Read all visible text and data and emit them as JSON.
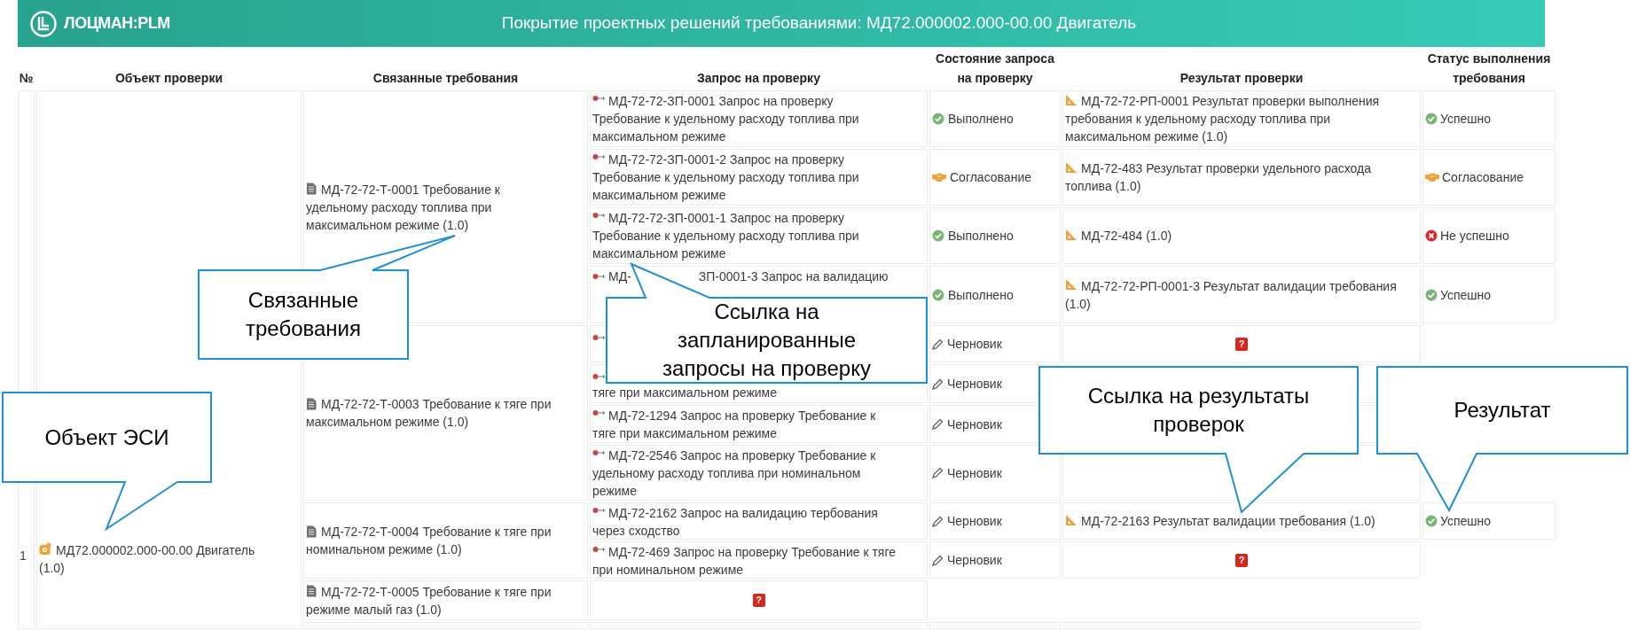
{
  "header": {
    "logo": "ЛОЦМАН:PLM",
    "title": "Покрытие проектных решений требованиями: МД72.000002.000-00.00 Двигатель"
  },
  "table": {
    "columns": [
      "№",
      "Объект проверки",
      "Связанные требования",
      "Запрос на проверку",
      "Состояние запроса на проверку",
      "Результат проверки",
      "Статус выполнения требования"
    ],
    "rows": [
      {
        "number": "1",
        "object": "МД72.000002.000-00.00 Двигатель (1.0)",
        "requirements": [
          {
            "text": "МД-72-72-Т-0001 Требование к удельному расходу топлива при максимальном режиме (1.0)",
            "requests": [
              {
                "kind": "link",
                "text": "МД-72-72-ЗП-0001 Запрос на проверку Требование к удельному расходу топлива при максимальном режиме",
                "state": {
                  "kind": "done",
                  "label": "Выполнено"
                },
                "result": {
                  "kind": "link",
                  "text": "МД-72-72-РП-0001 Результат проверки выполнения требования к удельному расходу топлива при максимальном режиме (1.0)"
                },
                "status": {
                  "kind": "success",
                  "label": "Успешно"
                }
              },
              {
                "kind": "link",
                "text": "МД-72-72-ЗП-0001-2 Запрос на проверку Требование к удельному расходу топлива при максимальном режиме",
                "state": {
                  "kind": "approval",
                  "label": "Согласование"
                },
                "result": {
                  "kind": "link",
                  "text": "МД-72-483 Результат проверки удельного расхода топлива (1.0)"
                },
                "status": {
                  "kind": "approval",
                  "label": "Согласование"
                }
              },
              {
                "kind": "link",
                "text": "МД-72-72-ЗП-0001-1 Запрос на проверку Требование к удельному расходу топлива при максимальном режиме",
                "state": {
                  "kind": "done",
                  "label": "Выполнено"
                },
                "result": {
                  "kind": "link",
                  "text": "МД-72-484 (1.0)"
                },
                "status": {
                  "kind": "fail",
                  "label": "Не успешно"
                }
              },
              {
                "kind": "split",
                "text": "МД-",
                "text_after": "ЗП-0001-3 Запрос на валидацию",
                "state": {
                  "kind": "done",
                  "label": "Выполнено"
                },
                "result": {
                  "kind": "link",
                  "text": "МД-72-72-РП-0001-3 Результат валидации требования (1.0)"
                },
                "status": {
                  "kind": "success",
                  "label": "Успешно"
                }
              }
            ]
          },
          {
            "text": "МД-72-72-Т-0003 Требование к тяге при максимальном режиме (1.0)",
            "requests": [
              {
                "kind": "covered",
                "state": {
                  "kind": "draft",
                  "label": "Черновик"
                },
                "result": {
                  "kind": "missing",
                  "label": "?"
                }
              },
              {
                "kind": "covered",
                "text": "тяге при максимальном режиме",
                "state": {
                  "kind": "draft",
                  "label": "Черновик"
                }
              },
              {
                "kind": "link",
                "text": "МД-72-1294 Запрос на проверку Требование к тяге при максимальном режиме",
                "state": {
                  "kind": "draft",
                  "label": "Черновик"
                }
              },
              {
                "kind": "link",
                "text": "МД-72-2546 Запрос на проверку Требование к удельному расходу топлива при номинальном режиме",
                "state": {
                  "kind": "draft",
                  "label": "Черновик"
                }
              }
            ]
          },
          {
            "text": "МД-72-72-Т-0004 Требование к тяге при номинальном режиме (1.0)",
            "requests": [
              {
                "kind": "link",
                "text": "МД-72-2162 Запрос на валидацию тербования через сходство",
                "state": {
                  "kind": "draft",
                  "label": "Черновик"
                },
                "result": {
                  "kind": "link",
                  "text": "МД-72-2163 Результат валидации требования (1.0)"
                },
                "status": {
                  "kind": "success",
                  "label": "Успешно"
                }
              },
              {
                "kind": "link",
                "text": "МД-72-469 Запрос на проверку Требование к тяге при номинальном режиме",
                "state": {
                  "kind": "draft",
                  "label": "Черновик"
                },
                "result": {
                  "kind": "missing",
                  "label": "?"
                }
              }
            ]
          },
          {
            "text": "МД-72-72-Т-0005 Требование к тяге при режиме малый газ (1.0)",
            "missing_requests": {
              "label": "?"
            }
          }
        ]
      }
    ]
  },
  "callouts": [
    {
      "text": "Связанные\nтребования"
    },
    {
      "text": "Ссылка на\nзапланированные\nзапросы на проверку"
    },
    {
      "text": "Ссылка на результаты\nпроверок"
    },
    {
      "text": "Результат"
    },
    {
      "text": "Объект ЭСИ"
    }
  ]
}
